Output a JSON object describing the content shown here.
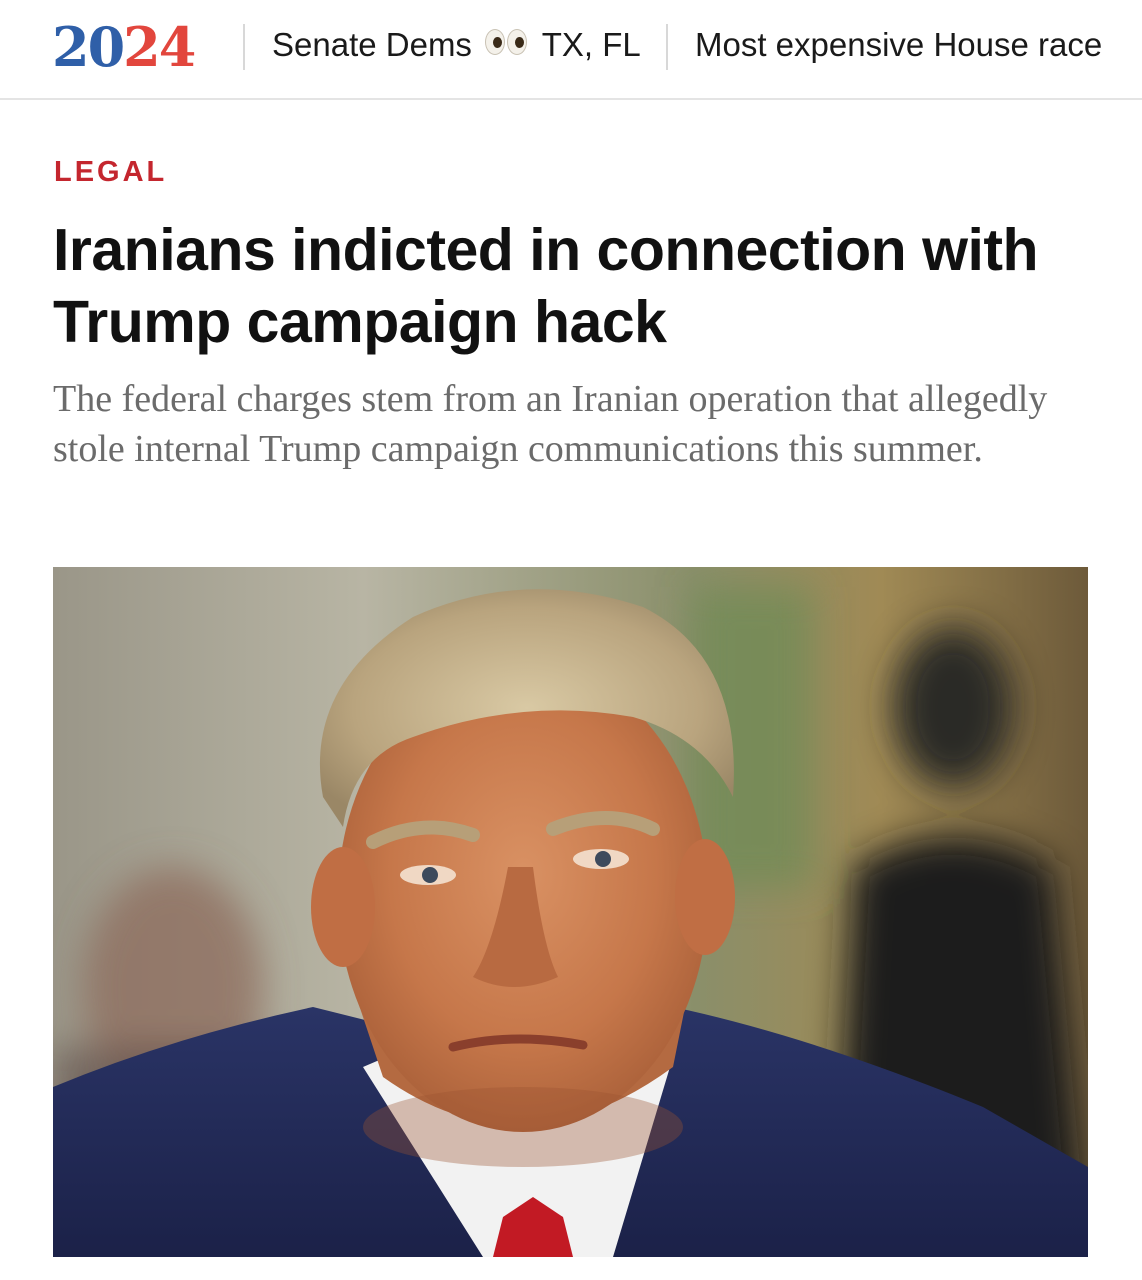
{
  "header": {
    "logo": {
      "digits": [
        "2",
        "0",
        "2",
        "4"
      ],
      "colors": {
        "blue": "#2f5fa8",
        "red": "#e2463d"
      }
    },
    "nav": [
      {
        "label_before": "Senate Dems",
        "emoji": "eyes-emoji",
        "label_after": "TX, FL"
      },
      {
        "label": "Most expensive House race"
      }
    ]
  },
  "article": {
    "category": "LEGAL",
    "category_color": "#c4262e",
    "headline": "Iranians indicted in connection with Trump campaign hack",
    "dek": "The federal charges stem from an Iranian operation that allegedly stole internal Trump campaign communications this summer.",
    "image": {
      "subject": "portrait-photo"
    }
  }
}
